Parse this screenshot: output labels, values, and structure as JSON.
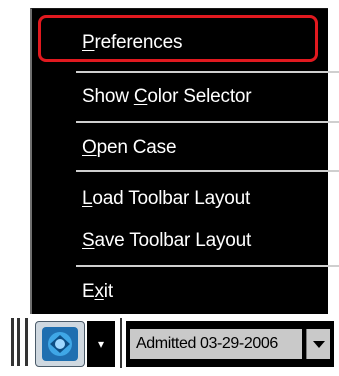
{
  "menu": {
    "items": [
      {
        "prefix": "",
        "accel": "P",
        "rest": "references"
      },
      {
        "prefix": "Show ",
        "accel": "C",
        "rest": "olor Selector"
      },
      {
        "prefix": "",
        "accel": "O",
        "rest": "pen Case"
      },
      {
        "prefix": "",
        "accel": "L",
        "rest": "oad Toolbar Layout"
      },
      {
        "prefix": "",
        "accel": "S",
        "rest": "ave Toolbar Layout"
      },
      {
        "prefix": "E",
        "accel": "x",
        "rest": "it"
      }
    ],
    "highlight_color": "#e1191f"
  },
  "toolbar": {
    "logo_icon": "app-logo-icon",
    "dropdown_arrow": "▾",
    "case_select_value": "Admitted 03-29-2006"
  }
}
